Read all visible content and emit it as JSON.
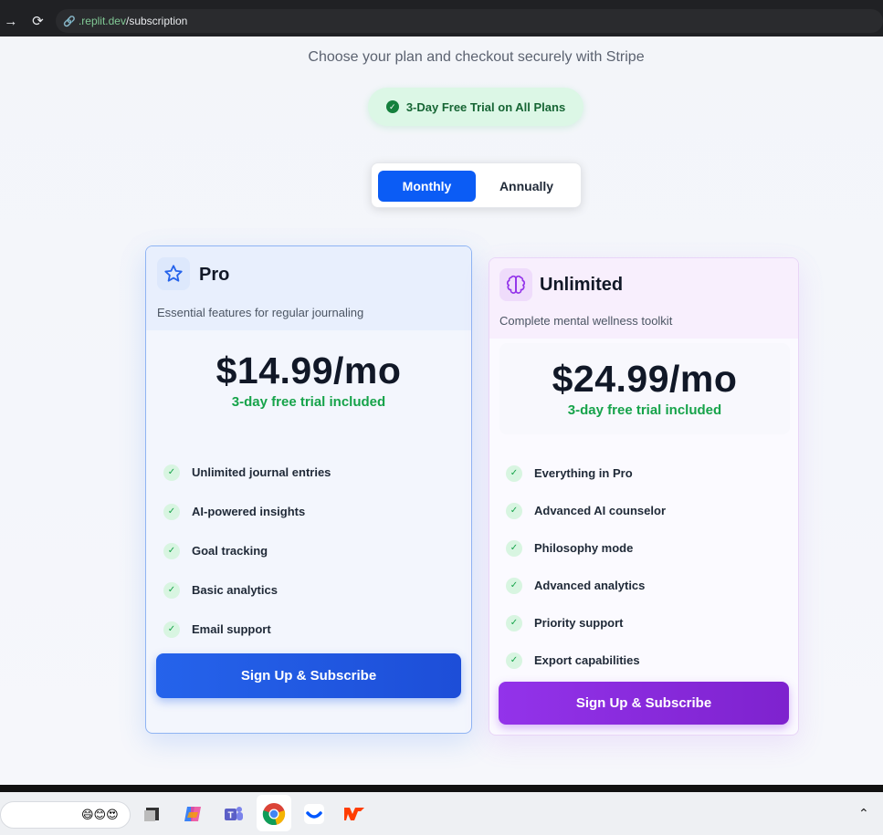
{
  "browser": {
    "url_host": ".replit.dev",
    "url_path": "/subscription"
  },
  "header": {
    "subtitle": "Choose your plan and checkout securely with Stripe",
    "trial_badge": "3-Day Free Trial on All Plans"
  },
  "billing_toggle": {
    "monthly": "Monthly",
    "annually": "Annually",
    "selected": "Monthly"
  },
  "plans": [
    {
      "name": "Pro",
      "description": "Essential features for regular journaling",
      "price": "$14.99/mo",
      "trial": "3-day free trial included",
      "features": [
        "Unlimited journal entries",
        "AI-powered insights",
        "Goal tracking",
        "Basic analytics",
        "Email support"
      ],
      "cta": "Sign Up & Subscribe",
      "icon": "star-icon",
      "accent": "#2563eb"
    },
    {
      "name": "Unlimited",
      "description": "Complete mental wellness toolkit",
      "price": "$24.99/mo",
      "trial": "3-day free trial included",
      "features": [
        "Everything in Pro",
        "Advanced AI counselor",
        "Philosophy mode",
        "Advanced analytics",
        "Priority support",
        "Export capabilities"
      ],
      "cta": "Sign Up & Subscribe",
      "icon": "brain-icon",
      "accent": "#9333ea"
    }
  ],
  "taskbar": {
    "apps": [
      "app-icon",
      "copilot-icon",
      "teams-icon",
      "chrome-icon",
      "app-icon",
      "app-icon"
    ]
  }
}
